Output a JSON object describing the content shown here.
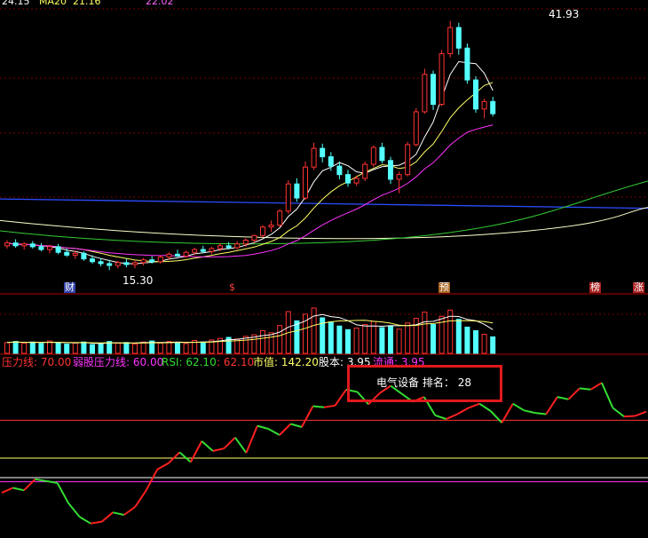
{
  "header_partial": {
    "ma1_value": "24.15",
    "ma2_label": "MA20",
    "ma2_value": "21.16",
    "ma3_value": "22.02"
  },
  "price_chart": {
    "high_label": "41.93",
    "low_label": "15.30",
    "markers": [
      "财",
      "$",
      "预",
      "榜",
      "涨"
    ]
  },
  "indicator_bar": {
    "pressure_line": "压力线: 70.00",
    "weak_pressure_line": "弱股压力线: 60.00",
    "rsi": "RSI: 62.10",
    "rsi2": ": 62.10",
    "market_value": "市值: 142.20",
    "share_capital": "股本: 3.95",
    "float_shares": "流通: 3.95"
  },
  "rank_box": {
    "sector": "电气设备",
    "rank_label": "排名：",
    "rank_value": "28"
  },
  "colors": {
    "up": "#ff3333",
    "down": "#54ffff",
    "grid": "#7a0000",
    "ma5": "#ffffff",
    "ma10": "#ffff66",
    "ma20": "#ff33ff",
    "ma60": "#33cc33",
    "blue_line": "#2b4dff",
    "rsi_up": "#ff2020",
    "rsi_down": "#33dd33"
  },
  "chart_data": [
    {
      "type": "candlestick",
      "title": "",
      "ylim": [
        14,
        43
      ],
      "candles": [
        [
          17.9,
          18.5,
          17.6,
          18.2
        ],
        [
          18.2,
          18.6,
          17.7,
          17.9
        ],
        [
          17.9,
          18.3,
          17.5,
          18.1
        ],
        [
          18.1,
          18.4,
          17.6,
          17.8
        ],
        [
          17.8,
          18.2,
          17.3,
          17.5
        ],
        [
          17.5,
          18.0,
          17.1,
          17.8
        ],
        [
          17.8,
          18.1,
          17.0,
          17.2
        ],
        [
          17.2,
          17.6,
          16.7,
          16.9
        ],
        [
          16.9,
          17.4,
          16.5,
          17.1
        ],
        [
          17.1,
          17.3,
          16.3,
          16.5
        ],
        [
          16.5,
          16.9,
          16.0,
          16.2
        ],
        [
          16.2,
          16.6,
          15.7,
          16.0
        ],
        [
          16.0,
          16.4,
          15.3,
          15.8
        ],
        [
          15.8,
          16.3,
          15.5,
          16.1
        ],
        [
          16.1,
          16.5,
          15.6,
          15.9
        ],
        [
          15.9,
          16.3,
          15.5,
          16.1
        ],
        [
          16.1,
          16.6,
          15.8,
          16.4
        ],
        [
          16.4,
          16.8,
          16.0,
          16.2
        ],
        [
          16.2,
          16.9,
          16.0,
          16.7
        ],
        [
          16.7,
          17.2,
          16.4,
          17.0
        ],
        [
          17.0,
          17.5,
          16.7,
          16.8
        ],
        [
          16.8,
          17.4,
          16.6,
          17.2
        ],
        [
          17.2,
          17.7,
          16.9,
          17.5
        ],
        [
          17.5,
          17.9,
          17.1,
          17.3
        ],
        [
          17.3,
          17.8,
          17.0,
          17.6
        ],
        [
          17.6,
          18.2,
          17.3,
          17.9
        ],
        [
          17.9,
          18.3,
          17.5,
          17.7
        ],
        [
          17.7,
          18.4,
          17.5,
          18.1
        ],
        [
          18.1,
          18.7,
          17.8,
          18.5
        ],
        [
          18.5,
          19.1,
          18.2,
          19.0
        ],
        [
          19.0,
          20.1,
          18.8,
          19.9
        ],
        [
          19.9,
          20.6,
          19.4,
          20.1
        ],
        [
          20.1,
          21.8,
          19.9,
          21.6
        ],
        [
          21.6,
          24.9,
          21.3,
          24.5
        ],
        [
          24.5,
          25.1,
          22.6,
          23.0
        ],
        [
          23.0,
          26.9,
          22.8,
          26.3
        ],
        [
          26.3,
          28.9,
          26.0,
          28.3
        ],
        [
          28.3,
          28.8,
          26.8,
          27.4
        ],
        [
          27.4,
          27.9,
          25.9,
          26.4
        ],
        [
          26.4,
          26.9,
          25.0,
          25.5
        ],
        [
          25.5,
          26.0,
          24.2,
          24.6
        ],
        [
          24.6,
          25.4,
          24.3,
          25.1
        ],
        [
          25.1,
          26.9,
          24.8,
          26.6
        ],
        [
          26.6,
          28.6,
          26.3,
          28.4
        ],
        [
          28.4,
          28.9,
          26.7,
          27.0
        ],
        [
          27.0,
          27.4,
          24.5,
          25.0
        ],
        [
          25.0,
          25.8,
          23.5,
          25.5
        ],
        [
          25.5,
          29.0,
          25.3,
          28.7
        ],
        [
          28.7,
          32.6,
          28.5,
          32.2
        ],
        [
          32.2,
          36.8,
          32.0,
          36.2
        ],
        [
          36.2,
          36.6,
          32.4,
          33.0
        ],
        [
          33.0,
          38.8,
          32.8,
          38.4
        ],
        [
          38.4,
          41.9,
          38.0,
          41.2
        ],
        [
          41.2,
          41.7,
          38.3,
          39.0
        ],
        [
          39.0,
          39.5,
          35.2,
          35.6
        ],
        [
          35.6,
          36.0,
          32.1,
          32.5
        ],
        [
          32.5,
          33.6,
          31.5,
          33.3
        ],
        [
          33.3,
          33.8,
          31.7,
          32.0
        ]
      ]
    },
    {
      "type": "bar",
      "title": "",
      "series": [
        {
          "values": [
            2.1,
            2.3,
            2.0,
            2.2,
            1.9,
            2.4,
            2.1,
            1.8,
            2.0,
            2.2,
            1.7,
            1.9,
            2.3,
            2.0,
            2.1,
            1.8,
            2.2,
            2.4,
            2.0,
            2.3,
            2.1,
            1.9,
            2.5,
            2.2,
            2.6,
            2.9,
            3.1,
            2.8,
            3.3,
            3.6,
            4.4,
            4.0,
            5.4,
            8.1,
            6.3,
            7.6,
            8.8,
            6.9,
            6.1,
            5.3,
            4.6,
            4.9,
            5.6,
            6.2,
            5.0,
            5.3,
            4.7,
            5.9,
            6.8,
            8.0,
            5.6,
            7.2,
            8.4,
            6.6,
            5.1,
            4.4,
            3.7,
            3.2
          ]
        }
      ],
      "ylim": [
        0,
        10
      ]
    },
    {
      "type": "line",
      "title": "",
      "series": [
        {
          "values": [
            58.2,
            59.0,
            58.6,
            60.4,
            60.1,
            59.8,
            56.5,
            54.3,
            53.2,
            53.5,
            55.0,
            54.6,
            55.9,
            58.6,
            62.0,
            63.0,
            64.8,
            63.2,
            66.6,
            65.0,
            65.4,
            67.2,
            64.7,
            69.1,
            68.6,
            67.6,
            69.4,
            68.9,
            72.3,
            72.1,
            72.4,
            75.0,
            74.6,
            72.6,
            74.4,
            75.6,
            74.3,
            73.0,
            73.8,
            70.8,
            70.2,
            71.0,
            72.0,
            72.7,
            71.5,
            69.6,
            72.7,
            71.6,
            71.2,
            71.0,
            73.8,
            73.4,
            75.2,
            75.0,
            76.1,
            72.0,
            70.6,
            70.7,
            71.4
          ]
        }
      ],
      "levels": [
        70,
        60
      ],
      "ylim": [
        52,
        78
      ]
    }
  ]
}
